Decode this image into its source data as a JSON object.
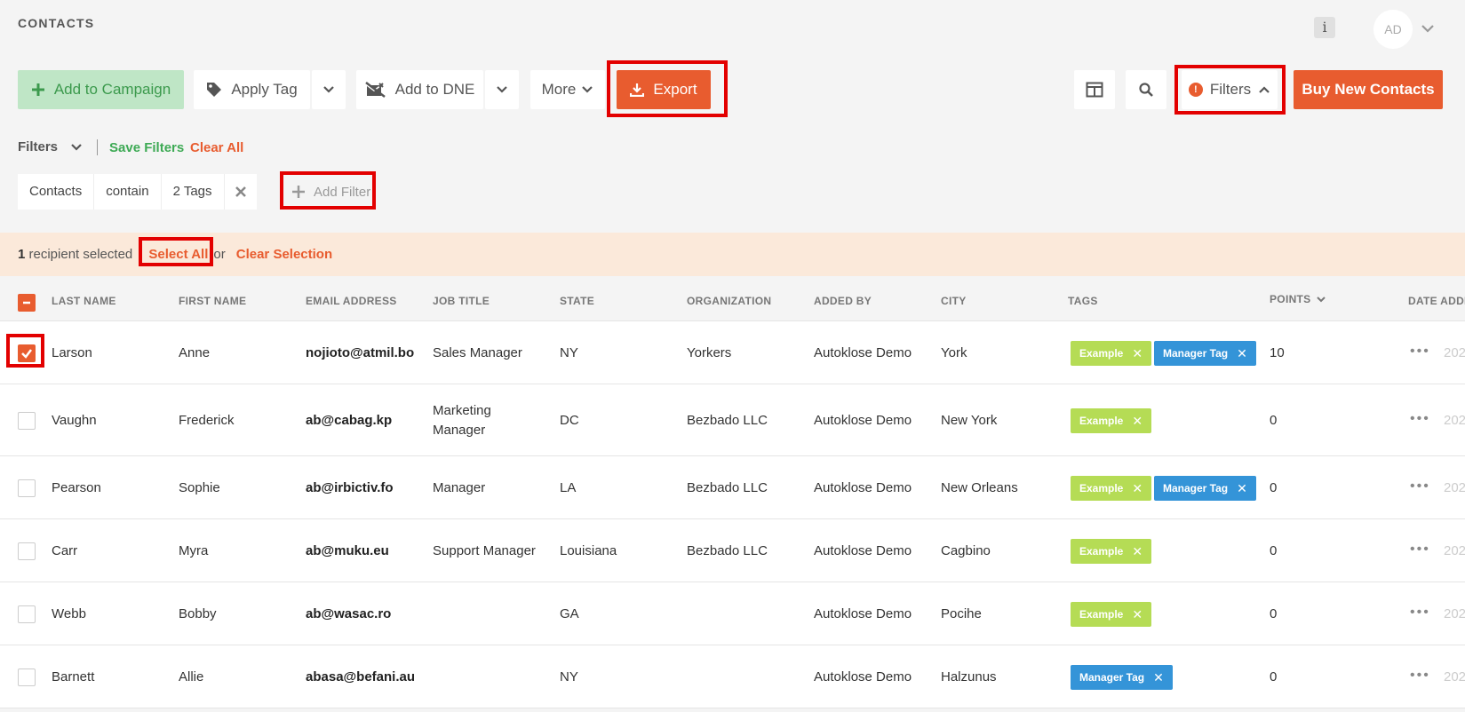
{
  "header": {
    "title": "CONTACTS",
    "info_glyph": "i",
    "avatar_initials": "AD"
  },
  "toolbar": {
    "add_to_campaign": "Add to Campaign",
    "apply_tag": "Apply Tag",
    "add_to_dne": "Add to DNE",
    "more": "More",
    "export": "Export",
    "filters": "Filters",
    "filters_badge": "!",
    "buy_new_contacts": "Buy New Contacts"
  },
  "filter_bar": {
    "label": "Filters",
    "save_filters": "Save Filters",
    "clear_all": "Clear All",
    "chip": {
      "field": "Contacts",
      "operator": "contain",
      "value": "2 Tags"
    },
    "add_filter": "Add Filter"
  },
  "selection_bar": {
    "count": "1",
    "text": "recipient selected",
    "select_all": "Select All",
    "or": "or",
    "clear_selection": "Clear Selection"
  },
  "table": {
    "columns": [
      "LAST NAME",
      "FIRST NAME",
      "EMAIL ADDRESS",
      "JOB TITLE",
      "STATE",
      "ORGANIZATION",
      "ADDED BY",
      "CITY",
      "TAGS",
      "POINTS",
      "DATE ADDED"
    ],
    "rows": [
      {
        "last": "Larson",
        "first": "Anne",
        "email": "nojioto@atmil.bo",
        "job": "Sales Manager",
        "state": "NY",
        "org": "Yorkers",
        "added_by": "Autoklose Demo",
        "city": "York",
        "tags": [
          "Example",
          "Manager Tag"
        ],
        "points": "10",
        "checked": true
      },
      {
        "last": "Vaughn",
        "first": "Frederick",
        "email": "ab@cabag.kp",
        "job": "Marketing Manager",
        "state": "DC",
        "org": "Bezbado LLC",
        "added_by": "Autoklose Demo",
        "city": "New York",
        "tags": [
          "Example"
        ],
        "points": "0",
        "checked": false
      },
      {
        "last": "Pearson",
        "first": "Sophie",
        "email": "ab@irbictiv.fo",
        "job": "Manager",
        "state": "LA",
        "org": "Bezbado LLC",
        "added_by": "Autoklose Demo",
        "city": "New Orleans",
        "tags": [
          "Example",
          "Manager Tag"
        ],
        "points": "0",
        "checked": false
      },
      {
        "last": "Carr",
        "first": "Myra",
        "email": "ab@muku.eu",
        "job": "Support Manager",
        "state": "Louisiana",
        "org": "Bezbado LLC",
        "added_by": "Autoklose Demo",
        "city": "Cagbino",
        "tags": [
          "Example"
        ],
        "points": "0",
        "checked": false
      },
      {
        "last": "Webb",
        "first": "Bobby",
        "email": "ab@wasac.ro",
        "job": "",
        "state": "GA",
        "org": "",
        "added_by": "Autoklose Demo",
        "city": "Pocihe",
        "tags": [
          "Example"
        ],
        "points": "0",
        "checked": false
      },
      {
        "last": "Barnett",
        "first": "Allie",
        "email": "abasa@befani.au",
        "job": "",
        "state": "NY",
        "org": "",
        "added_by": "Autoklose Demo",
        "city": "Halzunus",
        "tags": [
          "Manager Tag"
        ],
        "points": "0",
        "checked": false
      }
    ],
    "row_menu_glyph": "•••",
    "date_prefix": "202"
  },
  "colors": {
    "accent": "#e85c2f",
    "green": "#3eaa55",
    "tag_green": "#b5dc55",
    "tag_blue": "#3494d8",
    "highlight": "#e30000"
  }
}
